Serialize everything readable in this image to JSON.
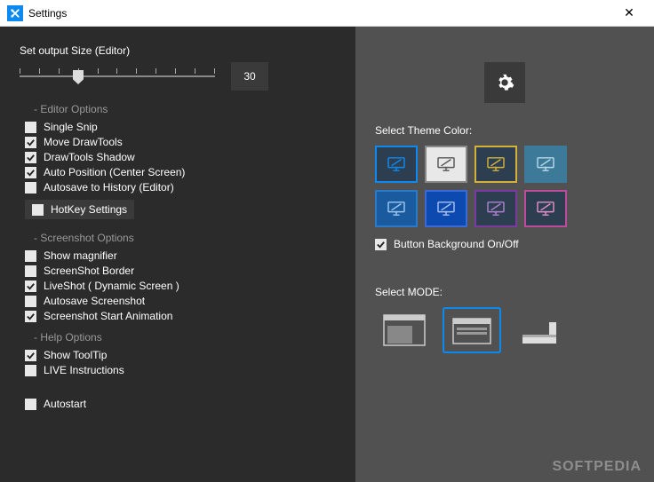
{
  "window": {
    "title": "Settings"
  },
  "left": {
    "sliderLabel": "Set output Size (Editor)",
    "sliderValue": "30",
    "sections": {
      "editor": {
        "head": "- Editor Options",
        "items": [
          {
            "label": "Single Snip",
            "checked": false
          },
          {
            "label": "Move DrawTools",
            "checked": true
          },
          {
            "label": "DrawTools Shadow",
            "checked": true
          },
          {
            "label": "Auto Position (Center Screen)",
            "checked": true
          },
          {
            "label": "Autosave to History (Editor)",
            "checked": false
          }
        ],
        "hotkey": "HotKey Settings"
      },
      "screenshot": {
        "head": "- Screenshot Options",
        "items": [
          {
            "label": "Show magnifier",
            "checked": false
          },
          {
            "label": "ScreenShot Border",
            "checked": false
          },
          {
            "label": "LiveShot ( Dynamic Screen )",
            "checked": true
          },
          {
            "label": "Autosave Screenshot",
            "checked": false
          },
          {
            "label": "Screenshot Start Animation",
            "checked": true
          }
        ]
      },
      "help": {
        "head": "- Help Options",
        "items": [
          {
            "label": "Show ToolTip",
            "checked": true
          },
          {
            "label": "LIVE Instructions",
            "checked": false
          }
        ]
      },
      "autostart": {
        "label": "Autostart",
        "checked": false
      }
    }
  },
  "right": {
    "themeLabel": "Select Theme Color:",
    "themes": [
      {
        "bg": "#2c3e50",
        "border": "#0d8af0",
        "iconStroke": "#0d8af0",
        "selected": true
      },
      {
        "bg": "#e8e8e8",
        "border": "#888",
        "iconStroke": "#555",
        "selected": false
      },
      {
        "bg": "#2c3e50",
        "border": "#d4b23a",
        "iconStroke": "#d4b23a",
        "selected": false
      },
      {
        "bg": "#3d7a99",
        "border": "#3d7a99",
        "iconStroke": "#b8d8e8",
        "selected": false
      },
      {
        "bg": "#1a5a9e",
        "border": "#2a7ac8",
        "iconStroke": "#9cc8f0",
        "selected": false
      },
      {
        "bg": "#0d4ab0",
        "border": "#3a6ad8",
        "iconStroke": "#a8c0f0",
        "selected": false
      },
      {
        "bg": "#2c3e50",
        "border": "#7a3a9e",
        "iconStroke": "#b080d0",
        "selected": false
      },
      {
        "bg": "#2c3e50",
        "border": "#c04a9e",
        "iconStroke": "#e090c8",
        "selected": false
      }
    ],
    "buttonBg": {
      "label": "Button Background On/Off",
      "checked": true
    },
    "modeLabel": "Select MODE:",
    "modes": [
      {
        "selected": false
      },
      {
        "selected": true
      },
      {
        "selected": false
      }
    ]
  },
  "watermark": "SOFTPEDIA"
}
